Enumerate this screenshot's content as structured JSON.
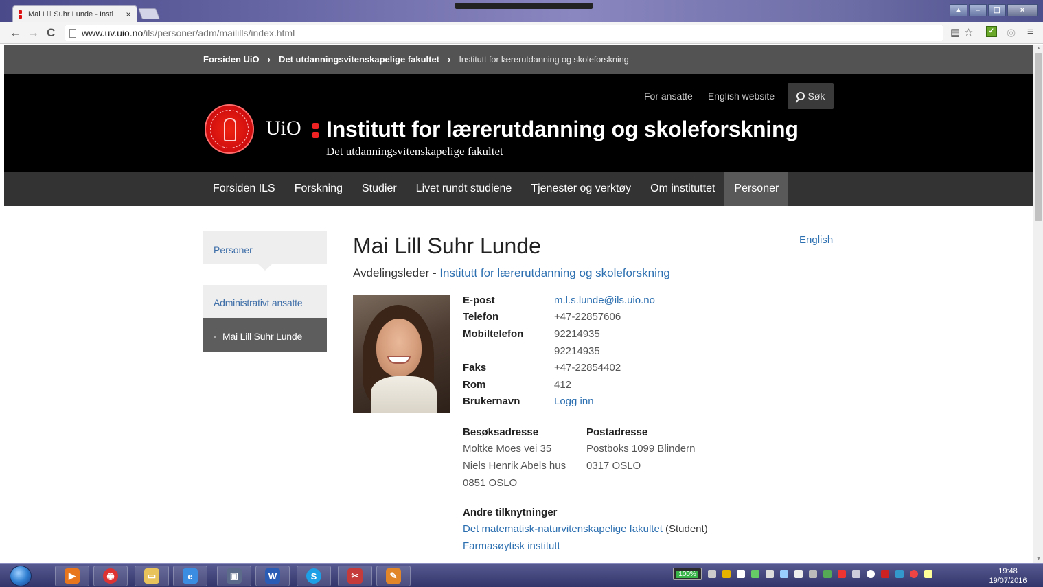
{
  "browser": {
    "tab_title": "Mai Lill Suhr Lunde - Insti",
    "tab_close": "×",
    "url_host": "www.uv.uio.no",
    "url_path": "/ils/personer/adm/mailills/index.html",
    "win_min": "–",
    "win_max": "❐",
    "win_close": "×"
  },
  "breadcrumb": {
    "items": [
      "Forsiden UiO",
      "Det utdanningsvitenskapelige fakultet"
    ],
    "current": "Institutt for lærerutdanning og skoleforskning",
    "separator": "›"
  },
  "header": {
    "links": [
      "For ansatte",
      "English website"
    ],
    "search_label": "Søk",
    "logo_text": "UiO",
    "title": "Institutt for lærerutdanning og skoleforskning",
    "subtitle": "Det utdanningsvitenskapelige fakultet"
  },
  "nav": {
    "items": [
      "Forsiden ILS",
      "Forskning",
      "Studier",
      "Livet rundt studiene",
      "Tjenester og verktøy",
      "Om instituttet",
      "Personer"
    ],
    "active_index": 6
  },
  "sidebar": {
    "top": "Personer",
    "sub": "Administrativt ansatte",
    "current": "Mai Lill Suhr Lunde"
  },
  "person": {
    "name": "Mai Lill Suhr Lunde",
    "role": "Avdelingsleder",
    "role_sep": " - ",
    "unit": "Institutt for lærerutdanning og skoleforskning",
    "language_link": "English",
    "contact": [
      {
        "label": "E-post",
        "value": "m.l.s.lunde@ils.uio.no",
        "link": true
      },
      {
        "label": "Telefon",
        "value": "+47-22857606",
        "link": false
      },
      {
        "label": "Mobiltelefon",
        "value": "92214935",
        "link": false
      },
      {
        "label": "",
        "value": "92214935",
        "link": false
      },
      {
        "label": "Faks",
        "value": "+47-22854402",
        "link": false
      },
      {
        "label": "Rom",
        "value": "412",
        "link": false
      },
      {
        "label": "Brukernavn",
        "value": "Logg inn",
        "link": true
      }
    ],
    "visit_address": {
      "heading": "Besøksadresse",
      "lines": [
        "Moltke Moes vei 35",
        "Niels Henrik Abels hus",
        "0851 OSLO"
      ]
    },
    "postal_address": {
      "heading": "Postadresse",
      "lines": [
        "Postboks 1099 Blindern",
        "0317 OSLO"
      ]
    },
    "affiliations": {
      "heading": "Andre tilknytninger",
      "items": [
        {
          "name": "Det matematisk-naturvitenskapelige fakultet",
          "note": "(Student)"
        },
        {
          "name": "Farmasøytisk institutt",
          "note": ""
        }
      ]
    }
  },
  "taskbar": {
    "battery": "100%",
    "time": "19:48",
    "date": "19/07/2016"
  },
  "colors": {
    "link": "#2c6fb0",
    "header_bg": "#000000",
    "nav_bg": "#333333",
    "nav_active": "#595959",
    "crumb_bg": "#535353",
    "uio_red": "#e22222"
  }
}
